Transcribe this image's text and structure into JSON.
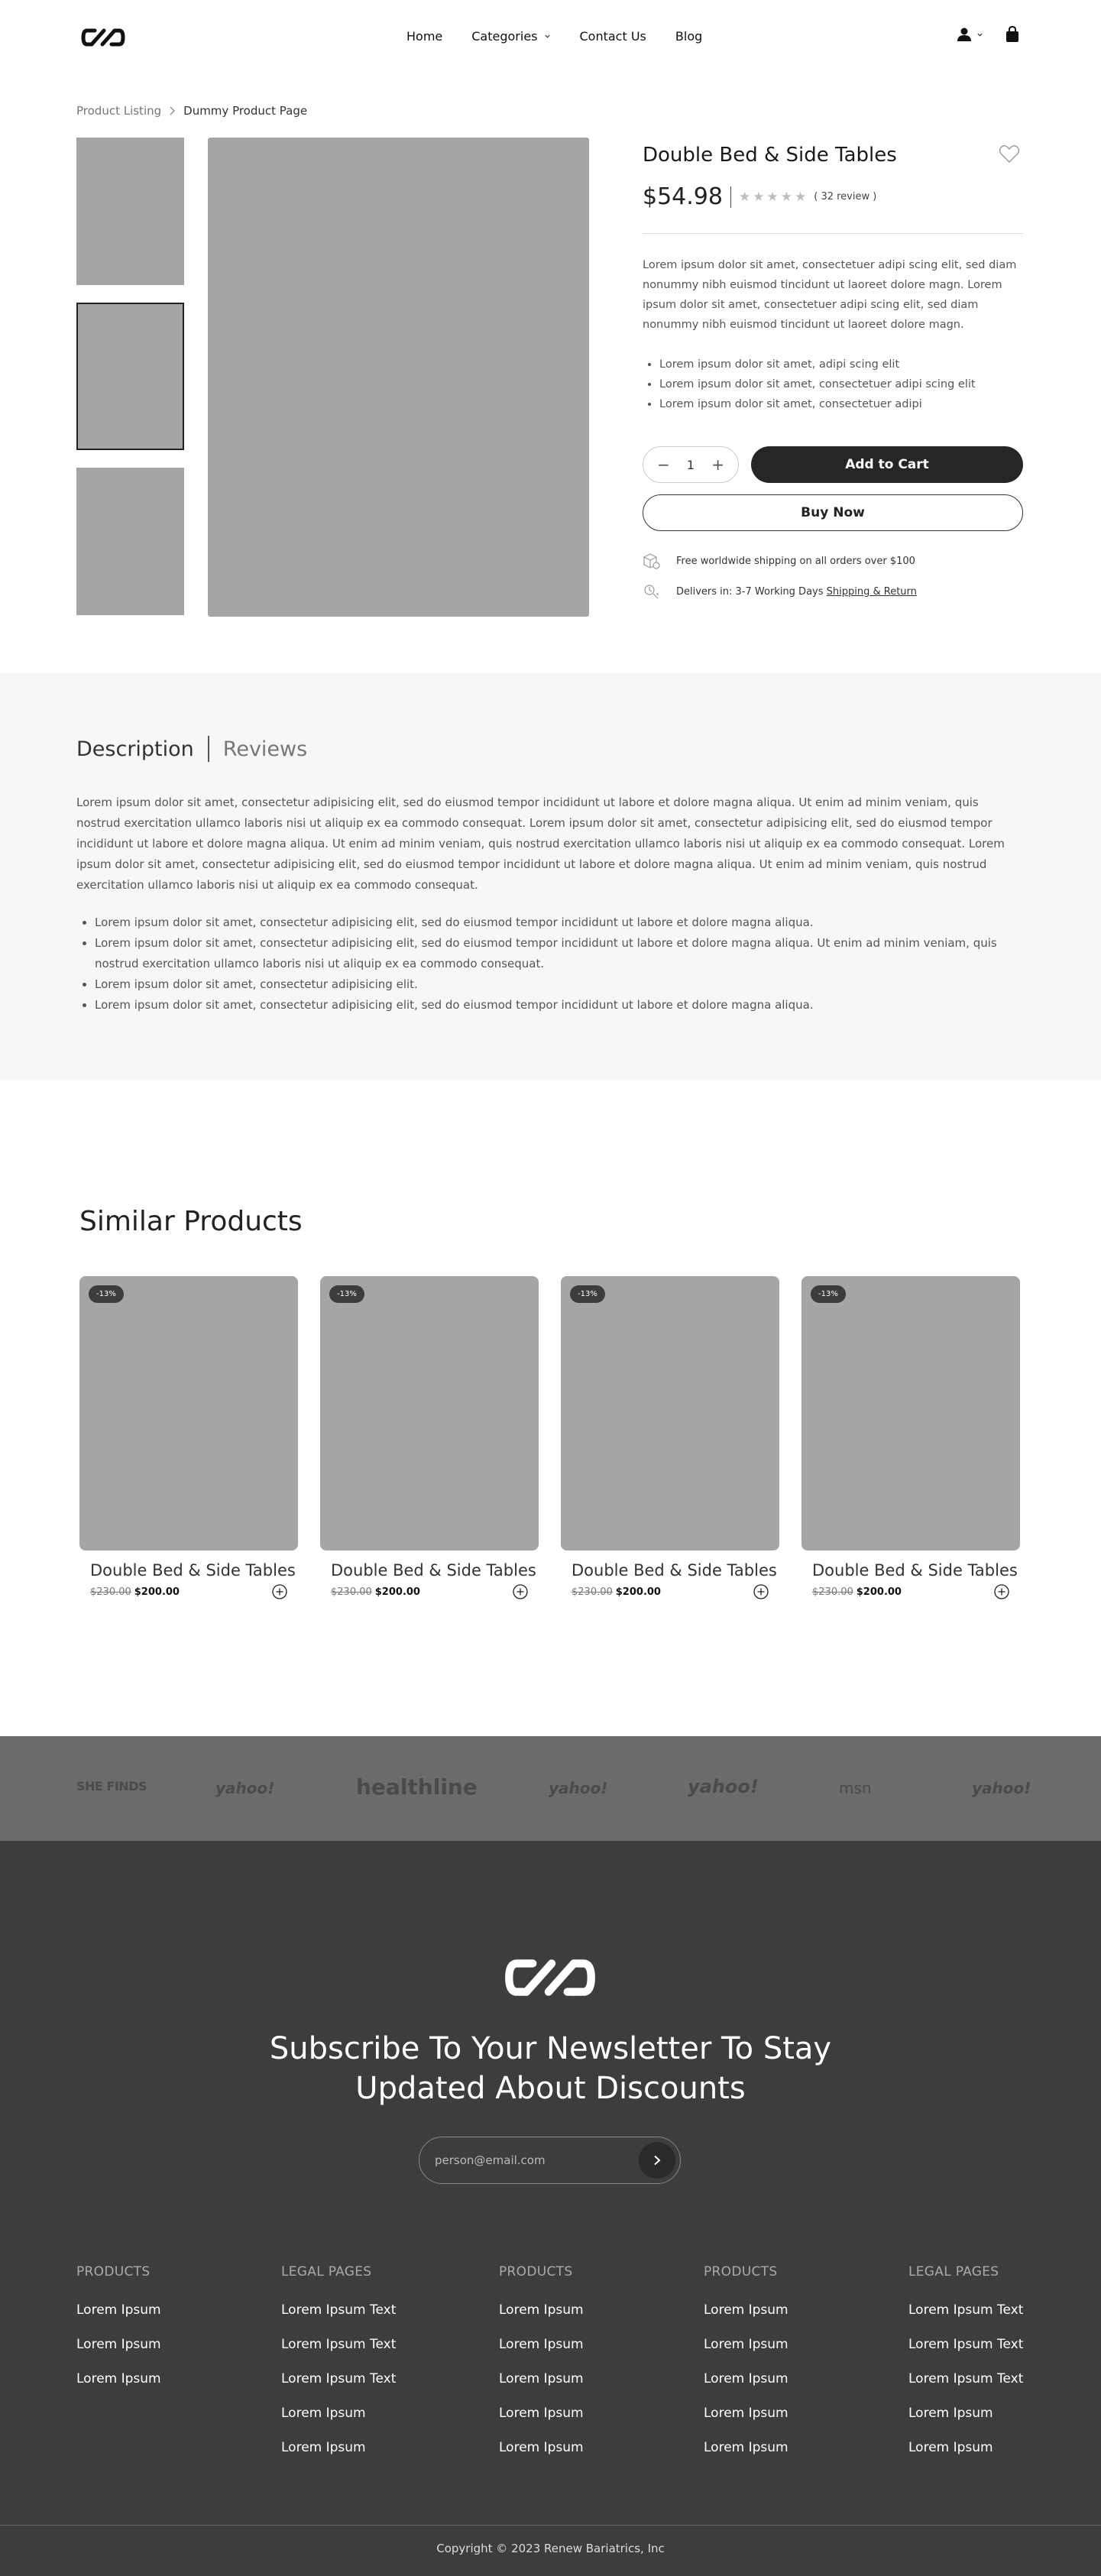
{
  "header": {
    "nav": [
      "Home",
      "Categories",
      "Contact Us",
      "Blog"
    ]
  },
  "breadcrumb": {
    "parent": "Product Listing",
    "current": "Dummy Product Page"
  },
  "product": {
    "title": "Double Bed & Side Tables",
    "price": "$54.98",
    "reviews": "( 32 review )",
    "rating": 0,
    "description": "Lorem ipsum dolor sit amet, consectetuer adipi scing elit, sed diam nonummy nibh euismod tincidunt ut laoreet dolore magn. Lorem ipsum dolor sit amet, consectetuer adipi scing elit, sed diam nonummy nibh euismod tincidunt ut laoreet dolore magn.",
    "bullets": [
      "Lorem ipsum dolor sit amet, adipi scing elit",
      "Lorem ipsum dolor sit amet, consectetuer adipi scing elit",
      "Lorem ipsum dolor sit amet, consectetuer adipi"
    ],
    "quantity": "1",
    "add_to_cart": "Add to Cart",
    "buy_now": "Buy Now",
    "shipping": "Free worldwide shipping on all orders over $100",
    "delivery": "Delivers in: 3-7 Working Days",
    "delivery_link": "Shipping & Return"
  },
  "tabs": {
    "description": "Description",
    "reviews": "Reviews"
  },
  "description": {
    "paragraph": "Lorem ipsum dolor sit amet, consectetur adipisicing elit, sed do eiusmod tempor incididunt ut labore et dolore magna aliqua. Ut enim ad minim veniam, quis nostrud exercitation ullamco laboris nisi ut aliquip ex ea commodo consequat. Lorem ipsum dolor sit amet, consectetur adipisicing elit, sed do eiusmod tempor incididunt ut labore et dolore magna aliqua. Ut enim ad minim veniam, quis nostrud exercitation ullamco laboris nisi ut aliquip ex ea commodo consequat. Lorem ipsum dolor sit amet, consectetur adipisicing elit, sed do eiusmod tempor incididunt ut labore et dolore magna aliqua. Ut enim ad minim veniam, quis nostrud exercitation ullamco laboris nisi ut aliquip ex ea commodo consequat.",
    "list": [
      "Lorem ipsum dolor sit amet, consectetur adipisicing elit, sed do eiusmod tempor incididunt ut labore et dolore magna aliqua.",
      "Lorem ipsum dolor sit amet, consectetur adipisicing elit, sed do eiusmod tempor incididunt ut labore et dolore magna aliqua. Ut enim ad minim veniam, quis nostrud exercitation ullamco laboris nisi ut aliquip ex ea commodo consequat.",
      "Lorem ipsum dolor sit amet, consectetur adipisicing elit.",
      "Lorem ipsum dolor sit amet, consectetur adipisicing elit, sed do eiusmod tempor incididunt ut labore et dolore magna aliqua."
    ]
  },
  "similar": {
    "title": "Similar Products",
    "items": [
      {
        "badge": "-13%",
        "name": "Double Bed & Side Tables",
        "old_price": "$230.00",
        "price": "$200.00"
      },
      {
        "badge": "-13%",
        "name": "Double Bed & Side Tables",
        "old_price": "$230.00",
        "price": "$200.00"
      },
      {
        "badge": "-13%",
        "name": "Double Bed & Side Tables",
        "old_price": "$230.00",
        "price": "$200.00"
      },
      {
        "badge": "-13%",
        "name": "Double Bed & Side Tables",
        "old_price": "$230.00",
        "price": "$200.00"
      }
    ]
  },
  "press": [
    "SHE FINDS",
    "yahoo!",
    "healthline",
    "yahoo!",
    "yahoo!",
    "msn",
    "yahoo!"
  ],
  "footer": {
    "heading_line1": "Subscribe To Your Newsletter To Stay",
    "heading_line2": "Updated About Discounts",
    "email_placeholder": "person@email.com",
    "columns": [
      {
        "title": "PRODUCTS",
        "links": [
          "Lorem Ipsum",
          "Lorem Ipsum",
          "Lorem Ipsum"
        ]
      },
      {
        "title": "LEGAL PAGES",
        "links": [
          "Lorem Ipsum Text",
          "Lorem Ipsum Text",
          "Lorem Ipsum Text",
          "Lorem Ipsum",
          "Lorem Ipsum"
        ]
      },
      {
        "title": "PRODUCTS",
        "links": [
          "Lorem Ipsum",
          "Lorem Ipsum",
          "Lorem Ipsum",
          "Lorem Ipsum",
          "Lorem Ipsum"
        ]
      },
      {
        "title": "PRODUCTS",
        "links": [
          "Lorem Ipsum",
          "Lorem Ipsum",
          "Lorem Ipsum",
          "Lorem Ipsum",
          "Lorem Ipsum"
        ]
      },
      {
        "title": "LEGAL PAGES",
        "links": [
          "Lorem Ipsum Text",
          "Lorem Ipsum Text",
          "Lorem Ipsum Text",
          "Lorem Ipsum",
          "Lorem Ipsum"
        ]
      }
    ],
    "copyright": "Copyright © 2023 Renew Bariatrics, Inc"
  }
}
